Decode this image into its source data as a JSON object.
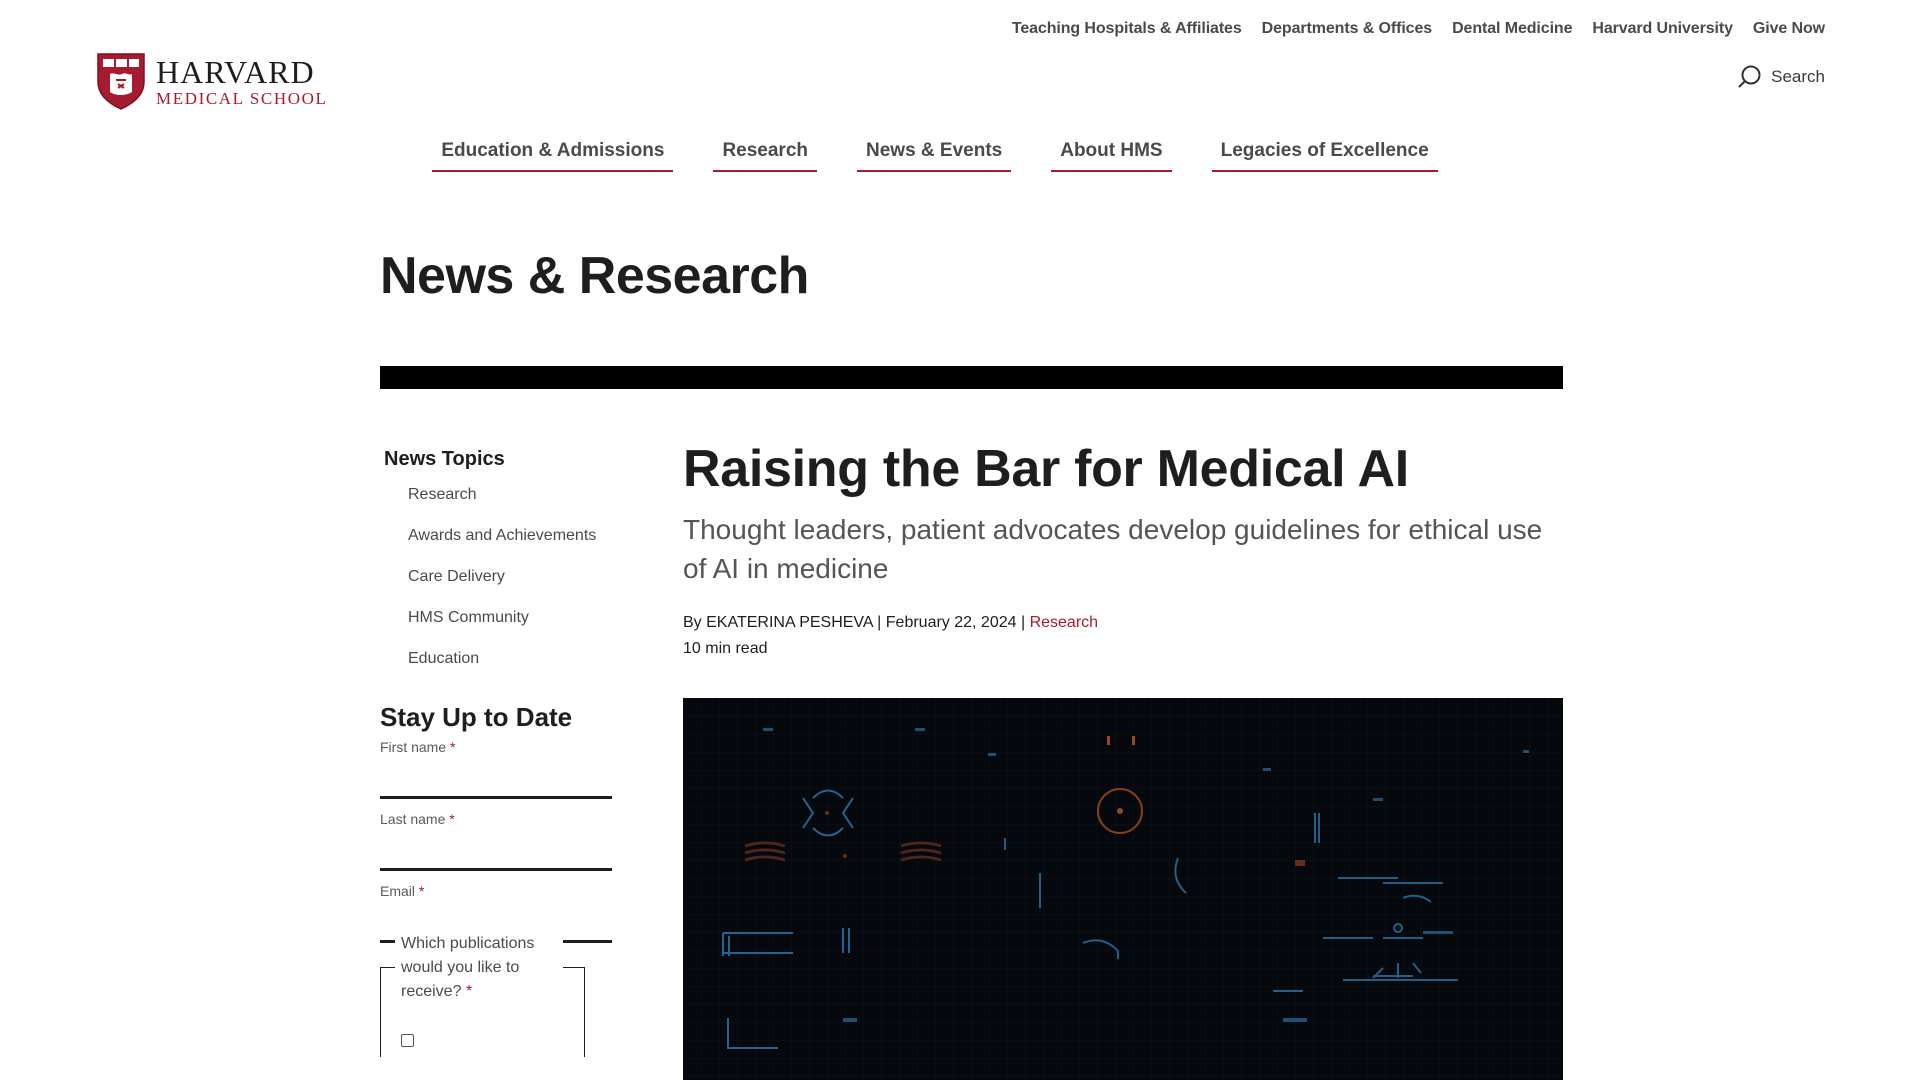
{
  "utility_nav": [
    "Teaching Hospitals & Affiliates",
    "Departments & Offices",
    "Dental Medicine",
    "Harvard University",
    "Give Now"
  ],
  "logo": {
    "line1": "HARVARD",
    "line2": "MEDICAL SCHOOL"
  },
  "search": {
    "label": "Search"
  },
  "main_nav": [
    "Education & Admissions",
    "Research",
    "News & Events",
    "About HMS",
    "Legacies of Excellence"
  ],
  "page": {
    "title": "News & Research"
  },
  "sidebar": {
    "topics_heading": "News Topics",
    "topics": [
      "Research",
      "Awards and Achievements",
      "Care Delivery",
      "HMS Community",
      "Education"
    ],
    "signup": {
      "heading": "Stay Up to Date",
      "first_name_label": "First name",
      "last_name_label": "Last name",
      "email_label": "Email",
      "required_mark": "*",
      "publications_label": "Which publications would you like to receive?"
    }
  },
  "article": {
    "title": "Raising the Bar for Medical AI",
    "subtitle": "Thought leaders, patient advocates develop guidelines for ethical use of AI in medicine",
    "by_prefix": "By",
    "author": "EKATERINA PESHEVA",
    "separator": "|",
    "date": "February 22, 2024",
    "category": "Research",
    "read_time": "10 min read"
  },
  "colors": {
    "brand_crimson": "#a51c30",
    "text": "#1e1e1e",
    "hero_bg": "#05080c",
    "hero_blue": "#2a6f9e",
    "hero_orange": "#c5541f"
  }
}
